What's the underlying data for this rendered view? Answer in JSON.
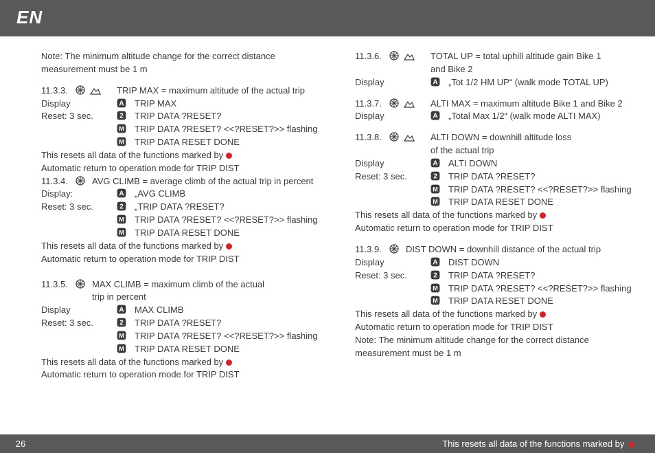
{
  "header": {
    "lang": "EN"
  },
  "col1": {
    "note_top": "Note: The minimum altitude change for the correct distance measurement must be 1 m",
    "s1133_id": "11.3.3.",
    "s1133_title": "TRIP MAX = maximum altitude of the actual trip",
    "display_lbl": "Display",
    "reset_lbl": "Reset: 3 sec.",
    "s1133_A": "TRIP MAX",
    "reset_2": "TRIP DATA ?RESET?",
    "reset_M1": "TRIP DATA ?RESET? <<?RESET?>> flashing",
    "reset_M2": "TRIP DATA RESET DONE",
    "resets_marked": "This resets all data of the functions marked by",
    "auto_return": "Automatic return to operation mode for TRIP DIST",
    "s1134_id": "11.3.4.",
    "s1134_title": "AVG CLIMB = average climb of the actual trip in percent",
    "display_lbl2": "Display:",
    "s1134_A": "„AVG CLIMB",
    "s1134_2": "„TRIP DATA ?RESET?",
    "s1135_id": "11.3.5.",
    "s1135_title1": "MAX CLIMB = maximum climb of the actual",
    "s1135_title2": "trip in percent",
    "s1135_A": "MAX CLIMB"
  },
  "col2": {
    "s1136_id": "11.3.6.",
    "s1136_title1": "TOTAL UP = total uphill altitude gain Bike 1",
    "s1136_title2": "and Bike 2",
    "display_lbl": "Display",
    "s1136_A": "„Tot 1/2 HM UP“ (walk mode TOTAL UP)",
    "s1137_id": "11.3.7.",
    "s1137_title": "ALTI MAX = maximum altitude Bike 1 and Bike 2",
    "s1137_A": "„Total Max 1/2“ (walk mode ALTI MAX)",
    "s1138_id": "11.3.8.",
    "s1138_title1": "ALTI DOWN = downhill altitude loss",
    "s1138_title2": "of the actual trip",
    "s1138_A": "ALTI DOWN",
    "reset_lbl": "Reset: 3 sec.",
    "reset_2": "TRIP DATA ?RESET?",
    "reset_M1": "TRIP DATA ?RESET? <<?RESET?>> flashing",
    "reset_M2": "TRIP DATA RESET DONE",
    "resets_marked": "This resets all data of the functions marked by",
    "auto_return": "Automatic return to operation mode for TRIP DIST",
    "s1139_id": "11.3.9.",
    "s1139_title": "DIST DOWN = downhill distance of the actual trip",
    "s1139_A": "DIST DOWN",
    "note_bottom": "Note: The minimum altitude change for the correct distance measurement must be 1 m"
  },
  "footer": {
    "page": "26",
    "right": "This resets all data of the functions marked by"
  }
}
